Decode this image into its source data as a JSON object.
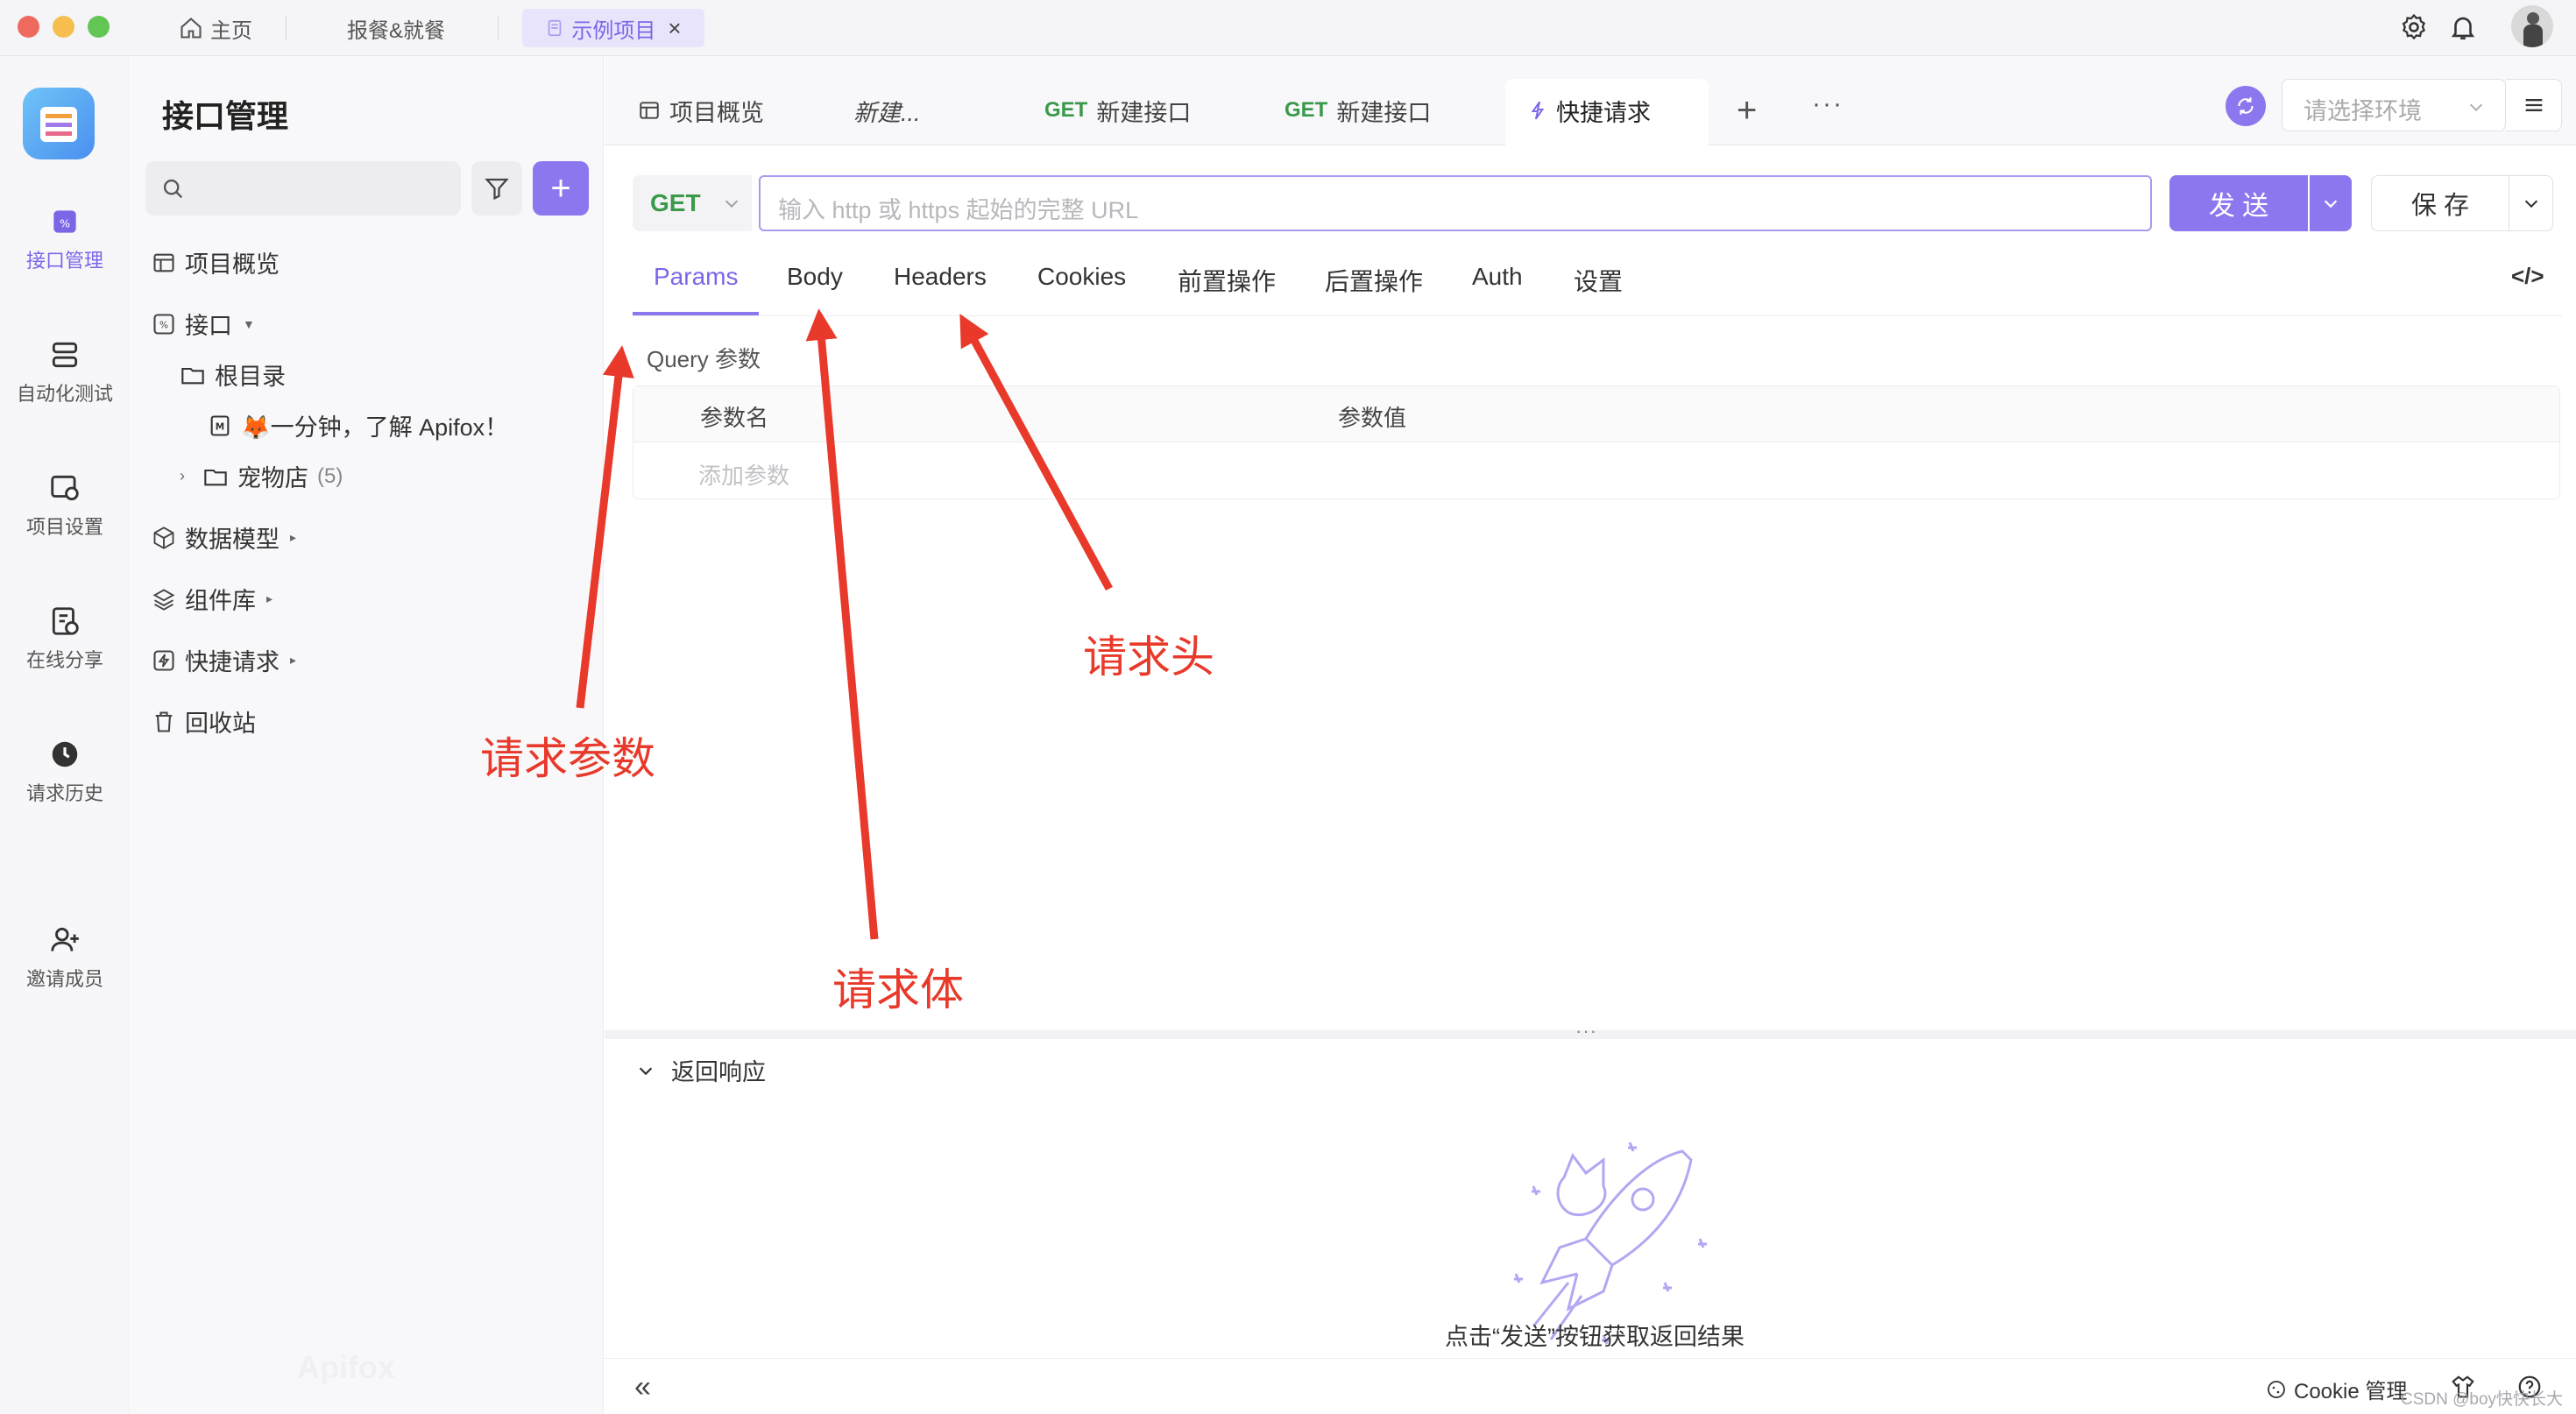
{
  "window": {
    "tabs": [
      {
        "label": "主页"
      },
      {
        "label": "报餐&就餐"
      },
      {
        "label": "示例项目"
      }
    ]
  },
  "rail": {
    "items": [
      {
        "label": "接口管理",
        "icon": "api-icon",
        "active": true
      },
      {
        "label": "自动化测试",
        "icon": "automation-icon"
      },
      {
        "label": "项目设置",
        "icon": "settings-icon"
      },
      {
        "label": "在线分享",
        "icon": "share-icon"
      },
      {
        "label": "请求历史",
        "icon": "history-icon"
      },
      {
        "label": "邀请成员",
        "icon": "invite-icon"
      }
    ]
  },
  "tree": {
    "title": "接口管理",
    "items": [
      {
        "label": "项目概览"
      },
      {
        "label": "接口"
      },
      {
        "label": "根目录"
      },
      {
        "label": "🦊一分钟，了解 Apifox！"
      },
      {
        "label": "宠物店",
        "count": "(5)"
      },
      {
        "label": "数据模型"
      },
      {
        "label": "组件库"
      },
      {
        "label": "快捷请求"
      },
      {
        "label": "回收站"
      }
    ],
    "watermark": "Apifox"
  },
  "main": {
    "tabs": [
      {
        "label": "项目概览"
      },
      {
        "label": "新建..."
      },
      {
        "method": "GET",
        "label": "新建接口"
      },
      {
        "method": "GET",
        "label": "新建接口"
      },
      {
        "label": "快捷请求"
      }
    ],
    "env_placeholder": "请选择环境",
    "request": {
      "method": "GET",
      "url_placeholder": "输入 http 或 https 起始的完整 URL",
      "send_label": "发 送",
      "save_label": "保 存"
    },
    "param_tabs": [
      "Params",
      "Body",
      "Headers",
      "Cookies",
      "前置操作",
      "后置操作",
      "Auth",
      "设置"
    ],
    "query_title": "Query 参数",
    "table_headers": [
      "参数名",
      "参数值"
    ],
    "add_param": "添加参数",
    "response_title": "返回响应",
    "response_hint": "点击“发送”按钮获取返回结果",
    "cookie_label": "Cookie 管理",
    "watermark": "CSDN @boy快快长大"
  },
  "annotations": {
    "params": "请求参数",
    "body": "请求体",
    "headers": "请求头",
    "color": "#e8392a"
  },
  "colors": {
    "accent": "#8d77ee",
    "get_green": "#3a9a4a"
  }
}
